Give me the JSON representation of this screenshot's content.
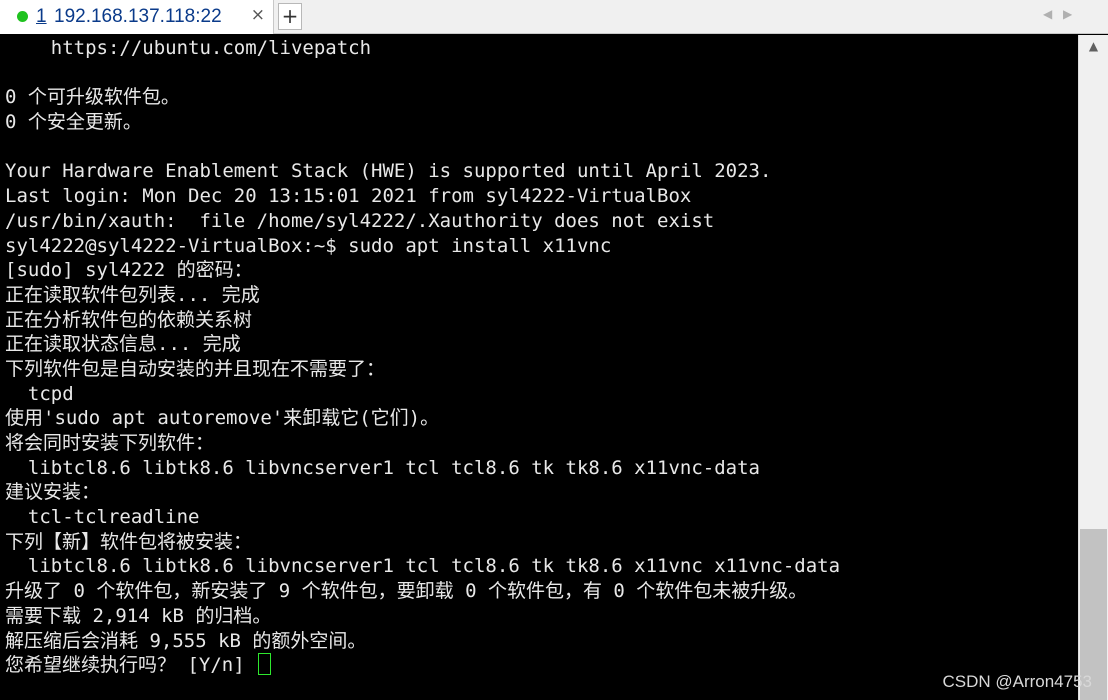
{
  "tab": {
    "index": "1",
    "title": "192.168.137.118:22",
    "close_icon": "×",
    "new_tab_icon": "+",
    "status_color": "#1fc21f"
  },
  "tab_scroll": {
    "left_icon": "◀",
    "right_icon": "▶"
  },
  "terminal": {
    "lines": [
      "    https://ubuntu.com/livepatch",
      "",
      "0 个可升级软件包。",
      "0 个安全更新。",
      "",
      "Your Hardware Enablement Stack (HWE) is supported until April 2023.",
      "Last login: Mon Dec 20 13:15:01 2021 from syl4222-VirtualBox",
      "/usr/bin/xauth:  file /home/syl4222/.Xauthority does not exist",
      "syl4222@syl4222-VirtualBox:~$ sudo apt install x11vnc",
      "[sudo] syl4222 的密码：",
      "正在读取软件包列表... 完成",
      "正在分析软件包的依赖关系树",
      "正在读取状态信息... 完成",
      "下列软件包是自动安装的并且现在不需要了：",
      "  tcpd",
      "使用'sudo apt autoremove'来卸载它(它们)。",
      "将会同时安装下列软件：",
      "  libtcl8.6 libtk8.6 libvncserver1 tcl tcl8.6 tk tk8.6 x11vnc-data",
      "建议安装：",
      "  tcl-tclreadline",
      "下列【新】软件包将被安装：",
      "  libtcl8.6 libtk8.6 libvncserver1 tcl tcl8.6 tk tk8.6 x11vnc x11vnc-data",
      "升级了 0 个软件包，新安装了 9 个软件包，要卸载 0 个软件包，有 0 个软件包未被升级。",
      "需要下载 2,914 kB 的归档。",
      "解压缩后会消耗 9,555 kB 的额外空间。",
      "您希望继续执行吗？ [Y/n] "
    ],
    "text_color": "#e8e8e8",
    "cursor_color": "#2ee82e"
  },
  "scrollbar": {
    "up_icon": "▲"
  },
  "watermark": "CSDN @Arron4753"
}
